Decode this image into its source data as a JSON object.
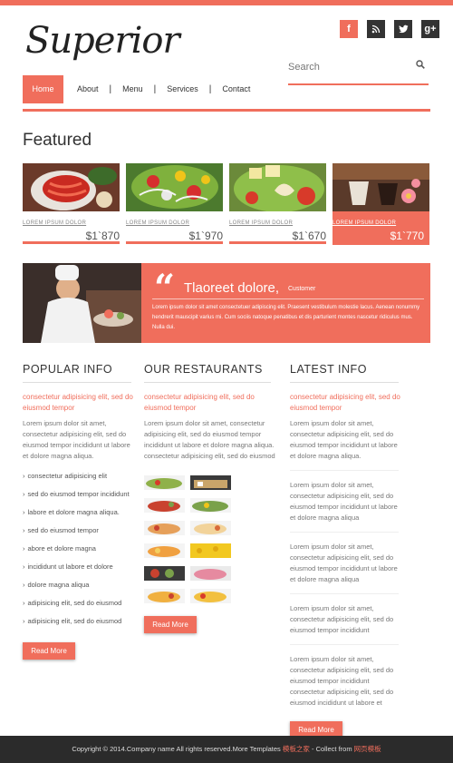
{
  "brand": {
    "logo_text": "Superior"
  },
  "colors": {
    "accent": "#f06e5c",
    "footer_bg": "#2b2b2b"
  },
  "social": [
    {
      "icon": "facebook-icon",
      "glyph": "f"
    },
    {
      "icon": "rss-icon",
      "glyph": "◦"
    },
    {
      "icon": "twitter-icon",
      "glyph": "t"
    },
    {
      "icon": "google-plus-icon",
      "glyph": "g+"
    }
  ],
  "search": {
    "placeholder": "Search",
    "icon": "search-icon"
  },
  "nav": {
    "items": [
      "Home",
      "About",
      "Menu",
      "Services",
      "Contact"
    ],
    "active": "Home"
  },
  "featured": {
    "title": "Featured",
    "cards": [
      {
        "label": "LOREM IPSUM DOLOR",
        "price": "$1`870"
      },
      {
        "label": "LOREM IPSUM DOLOR",
        "price": "$1`970"
      },
      {
        "label": "LOREM IPSUM DOLOR",
        "price": "$1`670"
      },
      {
        "label": "LOREM IPSUM DOLOR",
        "price": "$1`770"
      }
    ]
  },
  "testimonial": {
    "quote_mark": "“",
    "heading": "Tlaoreet dolore,",
    "author": "Customer",
    "text": "Lorem ipsum dolor sit amet consectetuer adipiscing elit. Praesent vestibulum molestie lacus. Aenean nonummy hendrerit mauscipit varius mi. Cum sociis natoque penatibus et dis parturient montes nascetur ridiculus mus. Nulla dui."
  },
  "popular": {
    "title": "POPULAR INFO",
    "sub": "consectetur adipisicing elit, sed do eiusmod tempor",
    "para": "Lorem ipsum dolor sit amet, consectetur adipisicing elit, sed do eiusmod tempor incididunt ut labore et dolore magna aliqua.",
    "bullets": [
      "consectetur adipisicing elit",
      "sed do eiusmod tempor incididunt",
      "labore et dolore magna aliqua.",
      "sed do eiusmod tempor",
      "abore et dolore magna",
      "incididunt ut labore et dolore",
      "dolore magna aliqua",
      "adipisicing elit, sed do eiusmod",
      "adipisicing elit, sed do eiusmod"
    ],
    "button": "Read More"
  },
  "restaurants": {
    "title": "OUR RESTAURANTS",
    "sub": "consectetur adipisicing elit, sed do eiusmod tempor",
    "para": "Lorem ipsum dolor sit amet, consectetur adipisicing elit, sed do eiusmod tempor incididunt ut labore et dolore magna aliqua. consectetur adipisicing elit, sed do eiusmod",
    "button": "Read More"
  },
  "latest": {
    "title": "LATEST INFO",
    "sub": "consectetur adipisicing elit, sed do eiusmod tempor",
    "blocks": [
      "Lorem ipsum dolor sit amet, consectetur adipisicing elit, sed do eiusmod tempor incididunt ut labore et dolore magna aliqua.",
      "Lorem ipsum dolor sit amet, consectetur adipisicing elit, sed do eiusmod tempor incididunt ut labore et dolore magna aliqua",
      "Lorem ipsum dolor sit amet, consectetur adipisicing elit, sed do eiusmod tempor incididunt ut labore et dolore magna aliqua",
      "Lorem ipsum dolor sit amet, consectetur adipisicing elit, sed do eiusmod tempor incididunt",
      "Lorem ipsum dolor sit amet, consectetur adipisicing elit, sed do eiusmod tempor incididunt consectetur adipisicing elit, sed do eiusmod incididunt ut labore et"
    ],
    "button": "Read More"
  },
  "footer": {
    "text": "Copyright © 2014.Company name All rights reserved.More Templates ",
    "link1": "模板之家",
    "mid": " - Collect from ",
    "link2": "网页模板"
  }
}
